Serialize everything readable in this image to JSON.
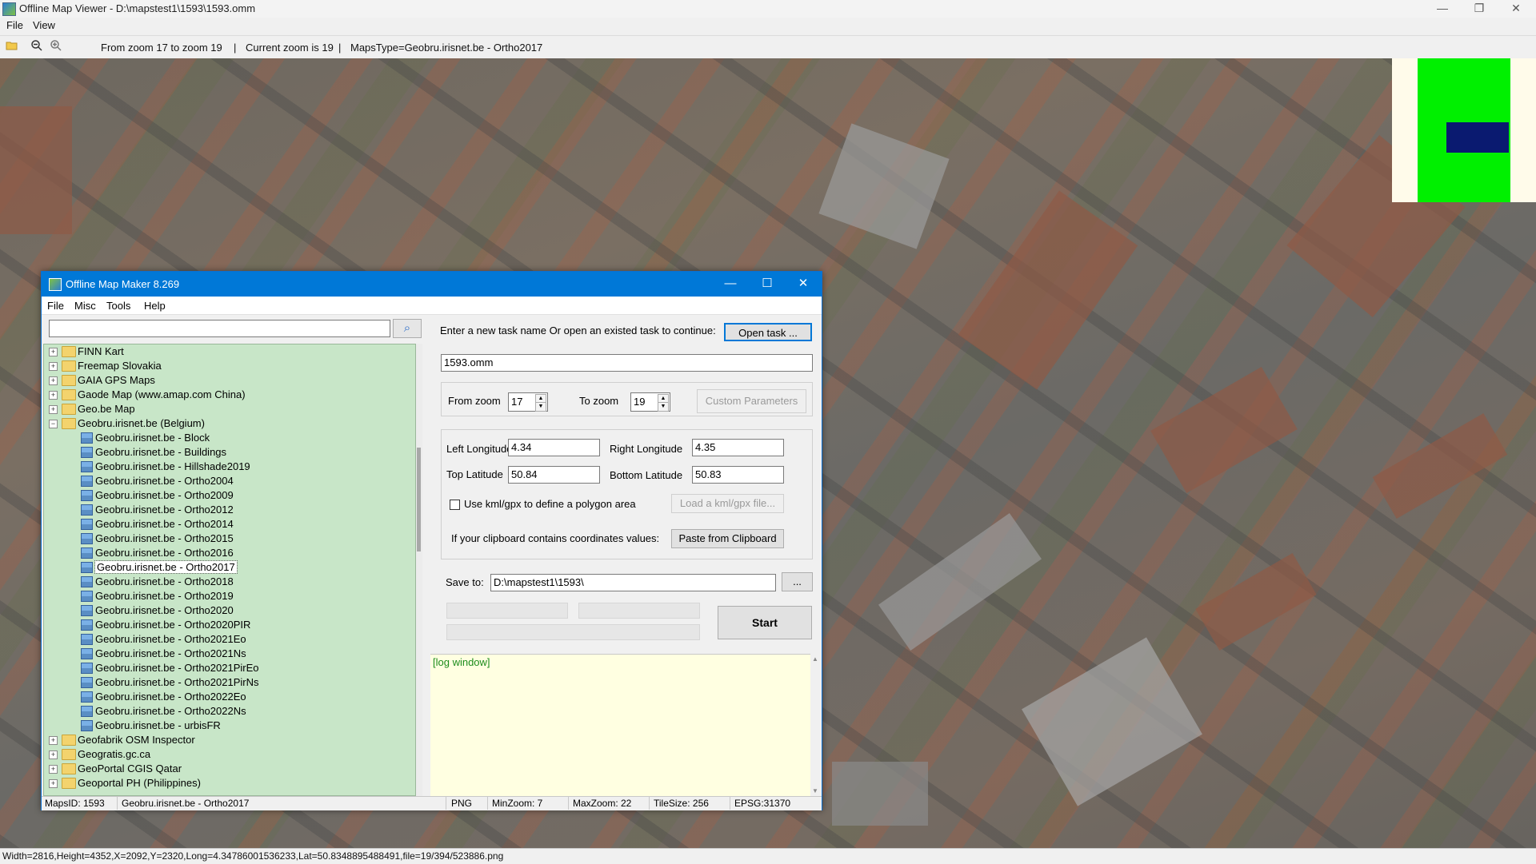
{
  "window": {
    "title": "Offline Map Viewer - D:\\mapstest1\\1593\\1593.omm",
    "menu": [
      "File",
      "View"
    ],
    "controls": {
      "minimize": "—",
      "restore": "❐",
      "close": "✕"
    }
  },
  "toolbar": {
    "zoom_range": "From zoom 17 to zoom 19",
    "separator": "|",
    "current_zoom": "Current zoom is 19",
    "maps_type": "MapsType=Geobru.irisnet.be - Ortho2017",
    "icons": [
      "open-folder-icon",
      "zoom-out-icon",
      "zoom-in-icon"
    ]
  },
  "statusbar": {
    "text": "Width=2816,Height=4352,X=2092,Y=2320,Long=4.34786001536233,Lat=50.8348895488491,file=19/394/523886.png"
  },
  "minimap": {
    "colors": {
      "background": "#fffbea",
      "coverage": "#00f000",
      "viewport": "#0a1a70"
    }
  },
  "dialog": {
    "title": "Offline Map Maker 8.269",
    "controls": {
      "minimize": "—",
      "maximize": "☐",
      "close": "✕"
    },
    "menu": [
      "File",
      "Misc",
      "Tools",
      "Help"
    ],
    "search": {
      "value": "",
      "icon": "search-icon"
    },
    "tree": [
      {
        "label": "FINN Kart",
        "type": "folder",
        "expanded": false
      },
      {
        "label": "Freemap Slovakia",
        "type": "folder",
        "expanded": false
      },
      {
        "label": "GAIA GPS Maps",
        "type": "folder",
        "expanded": false
      },
      {
        "label": "Gaode Map (www.amap.com China)",
        "type": "folder",
        "expanded": false
      },
      {
        "label": "Geo.be Map",
        "type": "folder",
        "expanded": false
      },
      {
        "label": "Geobru.irisnet.be (Belgium)",
        "type": "folder",
        "expanded": true
      },
      {
        "label": "Geobru.irisnet.be - Block",
        "type": "map"
      },
      {
        "label": "Geobru.irisnet.be - Buildings",
        "type": "map"
      },
      {
        "label": "Geobru.irisnet.be - Hillshade2019",
        "type": "map"
      },
      {
        "label": "Geobru.irisnet.be - Ortho2004",
        "type": "map"
      },
      {
        "label": "Geobru.irisnet.be - Ortho2009",
        "type": "map"
      },
      {
        "label": "Geobru.irisnet.be - Ortho2012",
        "type": "map"
      },
      {
        "label": "Geobru.irisnet.be - Ortho2014",
        "type": "map"
      },
      {
        "label": "Geobru.irisnet.be - Ortho2015",
        "type": "map"
      },
      {
        "label": "Geobru.irisnet.be - Ortho2016",
        "type": "map"
      },
      {
        "label": "Geobru.irisnet.be - Ortho2017",
        "type": "map",
        "selected": true
      },
      {
        "label": "Geobru.irisnet.be - Ortho2018",
        "type": "map"
      },
      {
        "label": "Geobru.irisnet.be - Ortho2019",
        "type": "map"
      },
      {
        "label": "Geobru.irisnet.be - Ortho2020",
        "type": "map"
      },
      {
        "label": "Geobru.irisnet.be - Ortho2020PIR",
        "type": "map"
      },
      {
        "label": "Geobru.irisnet.be - Ortho2021Eo",
        "type": "map"
      },
      {
        "label": "Geobru.irisnet.be - Ortho2021Ns",
        "type": "map"
      },
      {
        "label": "Geobru.irisnet.be - Ortho2021PirEo",
        "type": "map"
      },
      {
        "label": "Geobru.irisnet.be - Ortho2021PirNs",
        "type": "map"
      },
      {
        "label": "Geobru.irisnet.be - Ortho2022Eo",
        "type": "map"
      },
      {
        "label": "Geobru.irisnet.be - Ortho2022Ns",
        "type": "map"
      },
      {
        "label": "Geobru.irisnet.be - urbisFR",
        "type": "map"
      },
      {
        "label": "Geofabrik OSM Inspector",
        "type": "folder",
        "expanded": false
      },
      {
        "label": "Geogratis.gc.ca",
        "type": "folder",
        "expanded": false
      },
      {
        "label": "GeoPortal CGIS Qatar",
        "type": "folder",
        "expanded": false
      },
      {
        "label": "Geoportal PH (Philippines)",
        "type": "folder",
        "expanded": false
      }
    ],
    "task": {
      "prompt": "Enter a new task name Or open an existed task to continue:",
      "open_button": "Open task ...",
      "name": "1593.omm"
    },
    "zoom": {
      "from_label": "From zoom",
      "from_value": "17",
      "to_label": "To zoom",
      "to_value": "19",
      "custom_button": "Custom Parameters"
    },
    "coords": {
      "left_lon_label": "Left Longitude",
      "left_lon": "4.34",
      "right_lon_label": "Right Longitude",
      "right_lon": "4.35",
      "top_lat_label": "Top Latitude",
      "top_lat": "50.84",
      "bottom_lat_label": "Bottom Latitude",
      "bottom_lat": "50.83",
      "kml_checkbox_label": "Use kml/gpx to define a polygon area",
      "kml_checked": false,
      "kml_button": "Load a kml/gpx file...",
      "clipboard_label": "If your clipboard contains coordinates values:",
      "clipboard_button": "Paste from Clipboard"
    },
    "save": {
      "label": "Save to:",
      "path": "D:\\mapstest1\\1593\\",
      "browse_button": "..."
    },
    "start_button": "Start",
    "log": "[log window]",
    "status": {
      "maps_id": "MapsID: 1593",
      "map_name": "Geobru.irisnet.be - Ortho2017",
      "format": "PNG",
      "min_zoom": "MinZoom: 7",
      "max_zoom": "MaxZoom: 22",
      "tile_size": "TileSize: 256",
      "epsg": "EPSG:31370"
    },
    "colors": {
      "titlebar": "#0078d7",
      "tree_bg": "#c8e6c8",
      "log_bg": "#ffffe1",
      "log_text": "#1c8c1c"
    }
  }
}
